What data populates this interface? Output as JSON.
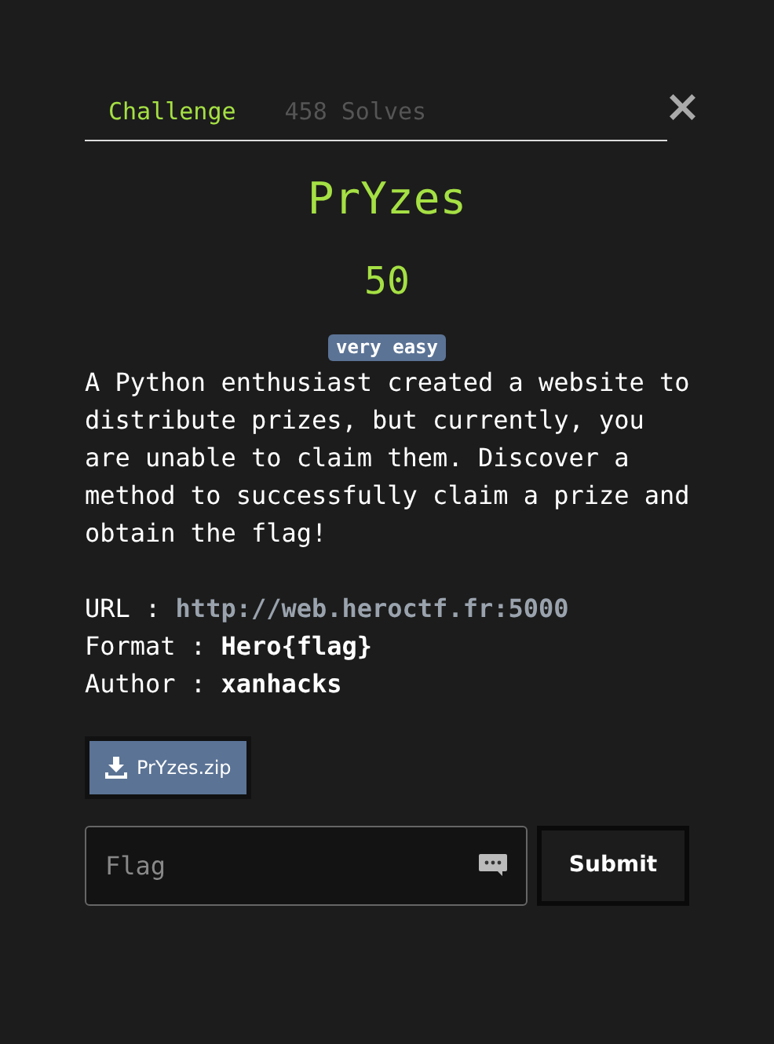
{
  "tabs": [
    {
      "label": "Challenge",
      "selected": true
    },
    {
      "label": "458 Solves",
      "selected": false
    }
  ],
  "close": {
    "label": "×"
  },
  "title": "PrYzes",
  "points": "50",
  "difficulty": "very easy",
  "description": "A Python enthusiast created a website to distribute prizes, but currently, you are unable to claim them. Discover a method to successfully claim a prize and obtain the flag!",
  "details": [
    {
      "kind": "link",
      "label": "URL : ",
      "value": "http://web.heroctf.fr:5000"
    },
    {
      "kind": "text",
      "label": "Format : ",
      "value": "Hero{flag}"
    },
    {
      "kind": "text",
      "label": "Author : ",
      "value": "xanhacks"
    }
  ],
  "file": {
    "label": "PrYzes.zip"
  },
  "flag_field": {
    "placeholder": "Flag"
  },
  "submit": {
    "label": "Submit"
  }
}
